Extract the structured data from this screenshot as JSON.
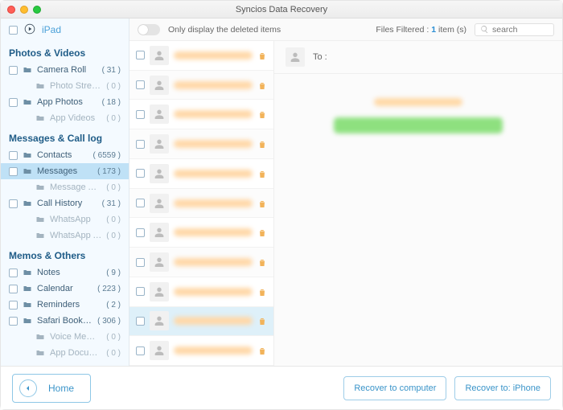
{
  "window_title": "Syncios Data Recovery",
  "device_name": "iPad",
  "filterbar": {
    "toggle_label": "Only display the deleted items",
    "filtered_prefix": "Files Filtered : ",
    "filtered_count": "1",
    "filtered_suffix": " item (s)",
    "search_placeholder": "search"
  },
  "sections": [
    {
      "title": "Photos & Videos",
      "items": [
        {
          "label": "Camera Roll",
          "count": "( 31 )",
          "sub": false
        },
        {
          "label": "Photo Stream",
          "count": "( 0 )",
          "sub": true
        },
        {
          "label": "App Photos",
          "count": "( 18 )",
          "sub": false
        },
        {
          "label": "App Videos",
          "count": "( 0 )",
          "sub": true
        }
      ]
    },
    {
      "title": "Messages & Call log",
      "items": [
        {
          "label": "Contacts",
          "count": "( 6559 )",
          "sub": false
        },
        {
          "label": "Messages",
          "count": "( 173 )",
          "sub": false,
          "selected": true
        },
        {
          "label": "Message Attach...",
          "count": "( 0 )",
          "sub": true
        },
        {
          "label": "Call History",
          "count": "( 31 )",
          "sub": false
        },
        {
          "label": "WhatsApp",
          "count": "( 0 )",
          "sub": true
        },
        {
          "label": "WhatsApp Attac...",
          "count": "( 0 )",
          "sub": true
        }
      ]
    },
    {
      "title": "Memos & Others",
      "items": [
        {
          "label": "Notes",
          "count": "( 9 )",
          "sub": false
        },
        {
          "label": "Calendar",
          "count": "( 223 )",
          "sub": false
        },
        {
          "label": "Reminders",
          "count": "( 2 )",
          "sub": false
        },
        {
          "label": "Safari Bookmark",
          "count": "( 306 )",
          "sub": false
        },
        {
          "label": "Voice Memos",
          "count": "( 0 )",
          "sub": true
        },
        {
          "label": "App Document",
          "count": "( 0 )",
          "sub": true
        }
      ]
    }
  ],
  "message_list": [
    {
      "selected": false
    },
    {
      "selected": false
    },
    {
      "selected": false
    },
    {
      "selected": false
    },
    {
      "selected": false
    },
    {
      "selected": false
    },
    {
      "selected": false
    },
    {
      "selected": false
    },
    {
      "selected": false
    },
    {
      "selected": true
    },
    {
      "selected": false
    }
  ],
  "detail": {
    "to_label": "To :"
  },
  "footer": {
    "home_label": "Home",
    "recover_computer": "Recover to computer",
    "recover_iphone": "Recover to: iPhone"
  }
}
